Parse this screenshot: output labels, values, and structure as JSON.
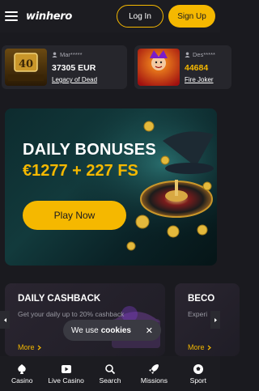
{
  "header": {
    "logo_text": "winhero",
    "login_label": "Log In",
    "signup_label": "Sign Up"
  },
  "winners": [
    {
      "user": "Mar*****",
      "amount": "37305 EUR",
      "game": "Legacy of Dead",
      "thumb_title": "LEGACY OF DEAD"
    },
    {
      "user": "Des*****",
      "amount": "44684",
      "game": "Fire Joker",
      "thumb_title": "FIRE JOKER"
    }
  ],
  "hero": {
    "title": "DAILY BONUSES",
    "subtitle": "€1277 + 227 FS",
    "play_label": "Play Now"
  },
  "promos": [
    {
      "title": "DAILY CASHBACK",
      "description": "Get your daily up to 20% cashback",
      "more": "More"
    },
    {
      "title": "BECO",
      "description": "Experi",
      "more": "More"
    }
  ],
  "cookie": {
    "text": "We use",
    "bold": "cookies",
    "close": "✕"
  },
  "nav": [
    {
      "label": "Casino",
      "icon": "casino-icon"
    },
    {
      "label": "Live Casino",
      "icon": "live-casino-icon"
    },
    {
      "label": "Search",
      "icon": "search-icon"
    },
    {
      "label": "Missions",
      "icon": "missions-icon"
    },
    {
      "label": "Sport",
      "icon": "sport-icon"
    }
  ],
  "colors": {
    "accent": "#f5b800",
    "background": "#1a1a1f",
    "card": "#26262c"
  }
}
